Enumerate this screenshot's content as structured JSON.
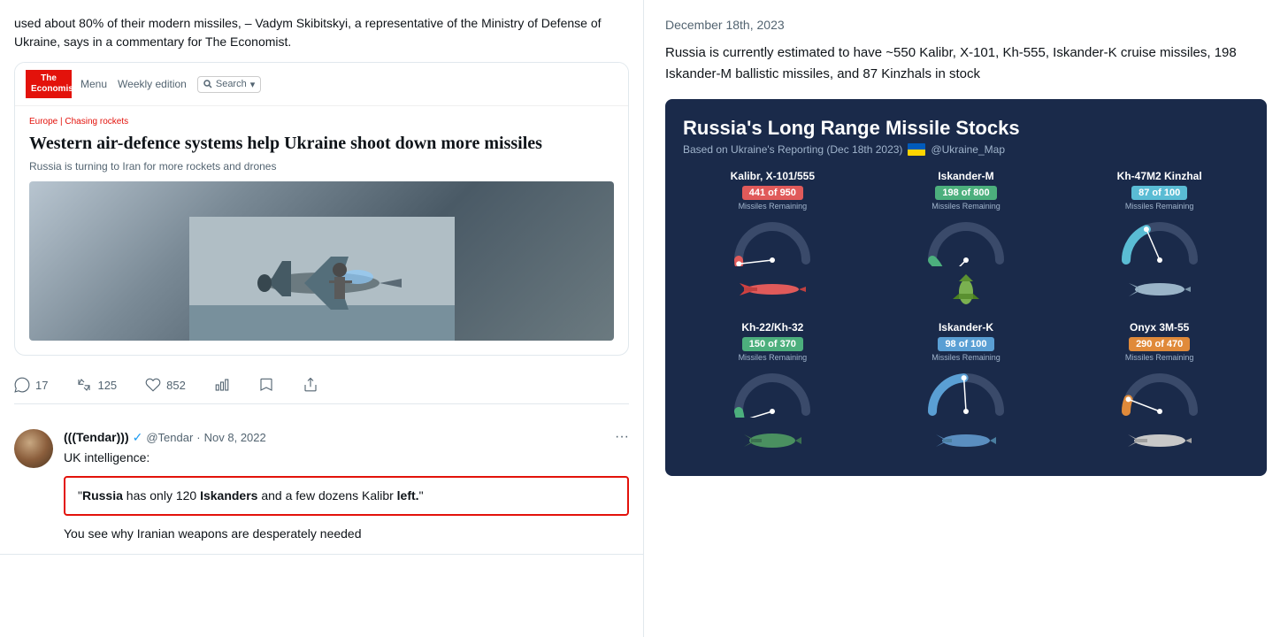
{
  "leftPanel": {
    "topTweet": {
      "text": "used about 80% of their modern missiles, – Vadym Skibitskyi, a representative of the Ministry of Defense of Ukraine, says in a commentary for The Economist.",
      "embedCard": {
        "logoLine1": "The",
        "logoLine2": "Economist",
        "navMenu": "Menu",
        "navEdition": "Weekly edition",
        "navSearch": "Search",
        "breadcrumb": "Europe | Chasing rockets",
        "articleTitle": "Western air-defence systems help Ukraine shoot down more missiles",
        "articleSubtitle": "Russia is turning to Iran for more rockets and drones"
      },
      "actions": {
        "reply": "17",
        "retweet": "125",
        "like": "852"
      }
    },
    "secondTweet": {
      "author": "(((Tendar)))",
      "handle": "@Tendar",
      "date": "Nov 8, 2022",
      "label": "UK intelligence:",
      "highlightText": "\"Russia has only 120 Iskanders and a few dozens Kalibr left.\"",
      "boldWords": [
        "Russia",
        "Iskanders"
      ],
      "bottomText": "You see why Iranian weapons are desperately needed"
    }
  },
  "rightPanel": {
    "date": "December 18th, 2023",
    "description": "Russia is currently estimated to have ~550 Kalibr, X-101, Kh-555, Iskander-K cruise missiles, 198 Iskander-M ballistic missiles, and 87 Kinzhals in stock",
    "infographic": {
      "title": "Russia's Long Range Missile Stocks",
      "subtitle": "Based on Ukraine's Reporting (Dec 18th 2023)",
      "handle": "@Ukraine_Map",
      "missiles": [
        {
          "name": "Kalibr, X-101/555",
          "badge": "441 of 950",
          "badgeClass": "badge-red",
          "label": "Missiles Remaining",
          "remaining": 441,
          "total": 950,
          "color": "#e05a5a",
          "bgColor": "#3a4a5a"
        },
        {
          "name": "Iskander-M",
          "badge": "198 of 800",
          "badgeClass": "badge-green",
          "label": "Missiles Remaining",
          "remaining": 198,
          "total": 800,
          "color": "#4caf7d",
          "bgColor": "#3a4a5a"
        },
        {
          "name": "Kh-47M2 Kinzhal",
          "badge": "87 of 100",
          "badgeClass": "badge-lightblue",
          "label": "Missiles Remaining",
          "remaining": 87,
          "total": 100,
          "color": "#5abcd4",
          "bgColor": "#3a4a5a"
        },
        {
          "name": "Kh-22/Kh-32",
          "badge": "150 of 370",
          "badgeClass": "badge-green",
          "label": "Missiles Remaining",
          "remaining": 150,
          "total": 370,
          "color": "#4caf7d",
          "bgColor": "#3a4a5a"
        },
        {
          "name": "Iskander-K",
          "badge": "98 of 100",
          "badgeClass": "badge-blue",
          "label": "Missiles Remaining",
          "remaining": 98,
          "total": 100,
          "color": "#5a9fd4",
          "bgColor": "#3a4a5a"
        },
        {
          "name": "Onyx 3M-55",
          "badge": "290 of 470",
          "badgeClass": "badge-orange",
          "label": "Missiles Remaining",
          "remaining": 290,
          "total": 470,
          "color": "#e08a3a",
          "bgColor": "#3a4a5a"
        }
      ]
    }
  }
}
